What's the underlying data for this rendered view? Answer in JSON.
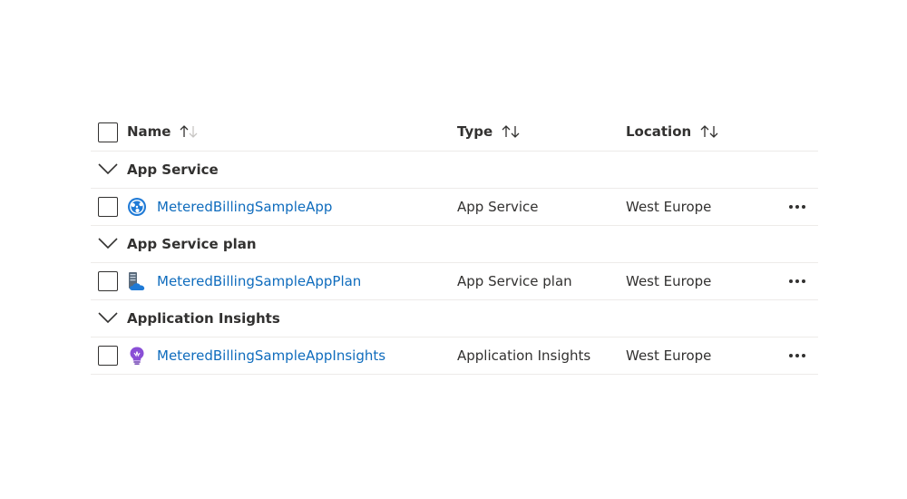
{
  "header": {
    "name": "Name",
    "type": "Type",
    "location": "Location"
  },
  "groups": [
    {
      "label": "App Service",
      "items": [
        {
          "name": "MeteredBillingSampleApp",
          "type": "App Service",
          "location": "West Europe",
          "icon": "app-service-icon"
        }
      ]
    },
    {
      "label": "App Service plan",
      "items": [
        {
          "name": "MeteredBillingSampleAppPlan",
          "type": "App Service plan",
          "location": "West Europe",
          "icon": "app-service-plan-icon"
        }
      ]
    },
    {
      "label": "Application Insights",
      "items": [
        {
          "name": "MeteredBillingSampleAppInsights",
          "type": "Application Insights",
          "location": "West Europe",
          "icon": "application-insights-icon"
        }
      ]
    }
  ],
  "colors": {
    "link": "#0f6cbd",
    "text": "#323130",
    "divider": "#edebe9"
  }
}
